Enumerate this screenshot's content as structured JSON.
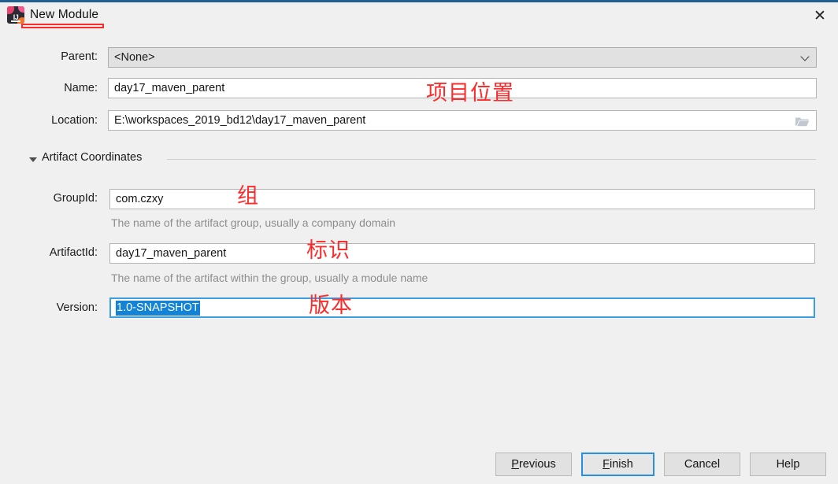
{
  "window": {
    "title": "New Module",
    "app_icon": "intellij-idea-icon",
    "icon_letters": "IJ",
    "close_label": "✕",
    "accent_color": "#1f6090",
    "background_color": "#f0f0f0"
  },
  "form": {
    "parent": {
      "label": "Parent:",
      "value": "<None>",
      "type": "combobox",
      "dropdown_icon": "chevron-down-icon"
    },
    "name": {
      "label": "Name:",
      "value": "day17_maven_parent",
      "type": "text"
    },
    "location": {
      "label": "Location:",
      "value": "E:\\workspaces_2019_bd12\\day17_maven_parent",
      "type": "text",
      "browse_icon": "folder-icon"
    }
  },
  "section": {
    "title": "Artifact Coordinates",
    "expanded": true,
    "toggle_icon": "triangle-down-icon"
  },
  "coordinates": {
    "group_id": {
      "label": "GroupId:",
      "value": "com.czxy",
      "hint": "The name of the artifact group, usually a company domain"
    },
    "artifact_id": {
      "label": "ArtifactId:",
      "value": "day17_maven_parent",
      "hint": "The name of the artifact within the group, usually a module name"
    },
    "version": {
      "label": "Version:",
      "value": "1.0-SNAPSHOT",
      "selected": true,
      "focused": true,
      "selection_color": "#1283d6"
    }
  },
  "annotations": {
    "color": "#fd2b2b",
    "title_underline": "",
    "location": "项目位置",
    "group": "组",
    "artifact": "标识",
    "version": "版本"
  },
  "buttons": {
    "previous": {
      "mnemonic": "P",
      "rest": "revious"
    },
    "finish": {
      "mnemonic": "F",
      "rest": "inish",
      "default": true
    },
    "cancel": {
      "label": "Cancel"
    },
    "help": {
      "label": "Help"
    }
  }
}
